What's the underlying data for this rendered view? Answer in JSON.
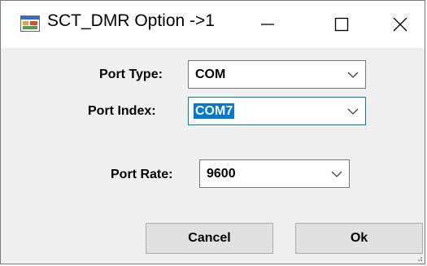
{
  "window": {
    "title": "SCT_DMR Option ->1",
    "icons": {
      "app": "app-window-icon",
      "minimize": "minimize-icon",
      "maximize": "maximize-icon",
      "close": "close-icon"
    }
  },
  "form": {
    "port_type": {
      "label": "Port Type:",
      "value": "COM"
    },
    "port_index": {
      "label": "Port Index:",
      "value": "COM7"
    },
    "port_rate": {
      "label": "Port Rate:",
      "value": "9600"
    }
  },
  "buttons": {
    "cancel_label": "Cancel",
    "ok_label": "Ok"
  },
  "colors": {
    "selection": "#0078d7",
    "button_face": "#e1e1e1",
    "dialog_bg": "#f0f0f0"
  }
}
